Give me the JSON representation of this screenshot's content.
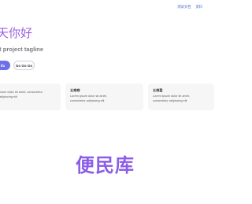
{
  "nav": {
    "items": [
      "测试文档",
      "资料"
    ]
  },
  "hero": {
    "title": "天你好",
    "tagline": "at project tagline",
    "primary_action": "ifu",
    "secondary_action": "Go Go Go"
  },
  "features": [
    {
      "title": "",
      "body": "psum dolor sit amet, consectetur adipiscing elit"
    },
    {
      "title": "五商商",
      "body": "Lorem ipsum dolor sit amet, consectetur adipiscing elit"
    },
    {
      "title": "五商盈",
      "body": "Lorem ipsum dolor sit amet, consectetur adipiscing elit"
    }
  ],
  "brand": {
    "text": "便民库"
  },
  "colors": {
    "accent": "#6d6fe8",
    "title_gradient": "#9c61e6",
    "brand": "#8b5de8",
    "nav_link": "#4a67c9",
    "card_bg": "#f6f6f7"
  }
}
